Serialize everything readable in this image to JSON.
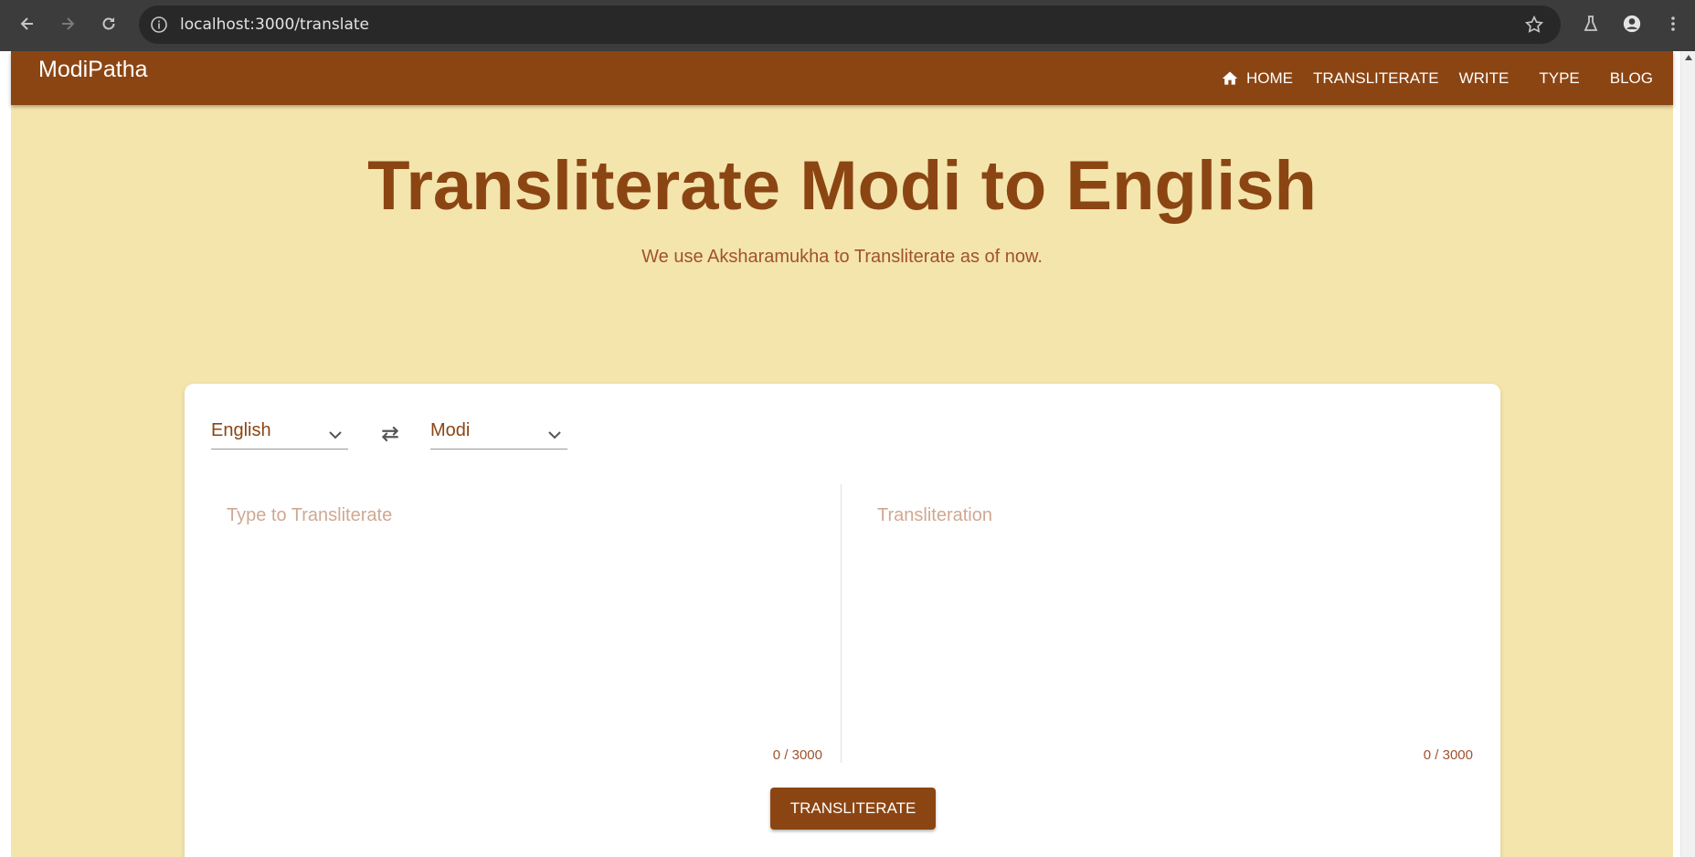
{
  "browser": {
    "url": "localhost:3000/translate",
    "icons": [
      "back-icon",
      "forward-icon",
      "reload-icon",
      "site-info-icon",
      "bookmark-star-icon",
      "labs-icon",
      "profile-icon",
      "menu-icon"
    ]
  },
  "navbar": {
    "brand": "ModiPatha",
    "items": [
      {
        "label": "HOME",
        "icon": "home-icon"
      },
      {
        "label": "TRANSLITERATE"
      },
      {
        "label": "WRITE"
      },
      {
        "label": "TYPE"
      },
      {
        "label": "BLOG"
      }
    ]
  },
  "hero": {
    "title": "Transliterate Modi to English",
    "subtitle": "We use Aksharamukha to Transliterate as of now."
  },
  "translator": {
    "source_language": "English",
    "target_language": "Modi",
    "input_placeholder": "Type to Transliterate",
    "output_placeholder": "Transliteration",
    "input_count": "0 / 3000",
    "output_count": "0 / 3000",
    "button_label": "TRANSLITERATE"
  },
  "colors": {
    "primary": "#8b4513",
    "background": "#f4e5ad",
    "subtitle": "#a0522d"
  }
}
